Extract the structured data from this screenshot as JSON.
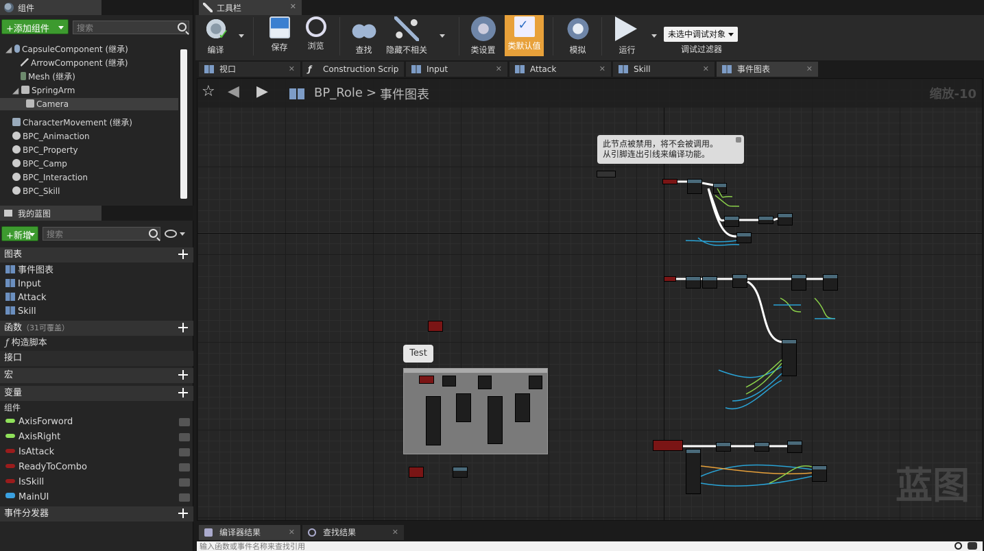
{
  "components_panel": {
    "tab_label": "组件",
    "add_button": "+添加组件",
    "search_placeholder": "搜索",
    "items": [
      {
        "label": "CapsuleComponent (继承)"
      },
      {
        "label": "ArrowComponent (继承)"
      },
      {
        "label": "Mesh (继承)"
      },
      {
        "label": "SpringArm"
      },
      {
        "label": "Camera"
      },
      {
        "label": "CharacterMovement (继承)"
      },
      {
        "label": "BPC_Animaction"
      },
      {
        "label": "BPC_Property"
      },
      {
        "label": "BPC_Camp"
      },
      {
        "label": "BPC_Interaction"
      },
      {
        "label": "BPC_Skill"
      }
    ]
  },
  "my_blueprint": {
    "tab_label": "我的蓝图",
    "new_button": "+新增",
    "search_placeholder": "搜索",
    "graphs_header": "图表",
    "graphs": [
      "事件图表",
      "Input",
      "Attack",
      "Skill"
    ],
    "functions_header": "函数",
    "functions_note": "（31可覆盖）",
    "functions": [
      "构造脚本"
    ],
    "interfaces_header": "接口",
    "macros_header": "宏",
    "variables_header": "变量",
    "components_sub": "组件",
    "variables": [
      {
        "name": "AxisForword",
        "color": "#8fe05a"
      },
      {
        "name": "AxisRight",
        "color": "#8fe05a"
      },
      {
        "name": "IsAttack",
        "color": "#9a1c1c"
      },
      {
        "name": "ReadyToCombo",
        "color": "#9a1c1c"
      },
      {
        "name": "IsSkill",
        "color": "#9a1c1c"
      },
      {
        "name": "MainUI",
        "color": "#3aa0e0"
      }
    ],
    "dispatchers_header": "事件分发器"
  },
  "toolbar": {
    "tab_label": "工具栏",
    "buttons": {
      "compile": "编译",
      "save": "保存",
      "browse": "浏览",
      "find": "查找",
      "hide_unrelated": "隐藏不相关",
      "class_settings": "类设置",
      "class_defaults": "类默认值",
      "simulate": "模拟",
      "play": "运行"
    },
    "debug_filter": {
      "selected": "未选中调试对象",
      "label": "调试过滤器"
    }
  },
  "doc_tabs": [
    "视口",
    "Construction Scrip",
    "Input",
    "Attack",
    "Skill",
    "事件图表"
  ],
  "graph": {
    "breadcrumb_root": "BP_Role",
    "breadcrumb_sep": ">",
    "breadcrumb_current": "事件图表",
    "zoom": "缩放-10",
    "watermark": "蓝图",
    "disabled_tooltip_line1": "此节点被禁用，将不会被调用。",
    "disabled_tooltip_line2": "从引脚连出引线来编译功能。",
    "comment_title": "Test"
  },
  "bottom": {
    "tabs": [
      "编译器结果",
      "查找结果"
    ],
    "search_placeholder": "输入函数或事件名称来查找引用"
  }
}
